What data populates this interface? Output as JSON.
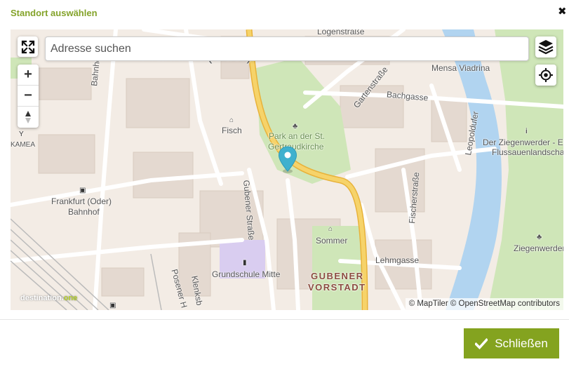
{
  "modal": {
    "title": "Standort auswählen",
    "close_symbol": "✖",
    "close_button_label": "Schließen"
  },
  "search": {
    "placeholder": "Adresse suchen",
    "value": ""
  },
  "map": {
    "zoom_in": "+",
    "zoom_out": "−",
    "attribution": "© MapTiler © OpenStreetMap contributors",
    "brand_main": "destination.",
    "brand_accent": "one",
    "labels": {
      "city": "Frankfurt (Oder)",
      "logenstrasse": "Logenstraße",
      "mensa": "Mensa Viadrina",
      "bahnhofstr": "Bahnhofst",
      "gartenstrasse": "Gartenstraße",
      "bachgasse": "Bachgasse",
      "fisch": "Fisch",
      "park1": "Park an der St.",
      "park2": "Gertraudkirche",
      "kamea": "KAMEA",
      "ziegenwerder1": "Der Ziegenwerder - Ei",
      "ziegenwerder2": "Flussauenlandschaf",
      "leopoldufer": "Leopoldufer",
      "bahnhof1": "Frankfurt (Oder)",
      "bahnhof2": "Bahnhof",
      "gubener_strasse": "Gubener Straße",
      "fischerstrasse": "Fischerstraße",
      "sommer": "Sommer",
      "ziegenwerder": "Ziegenwerder",
      "lehmgasse": "Lehmgasse",
      "grundschule": "Grundschule Mitte",
      "district1": "GUBENER",
      "district2": "VORSTADT",
      "posener": "Posener H",
      "klenksb": "Klenksb"
    }
  },
  "icons": {
    "close": "close-icon",
    "fullscreen": "fullscreen-icon",
    "layers": "layers-icon",
    "locate": "locate-icon",
    "compass": "compass-icon",
    "marker": "map-marker-icon",
    "check": "check-icon"
  },
  "colors": {
    "accent": "#84a31f",
    "title": "#84a32a",
    "marker": "#3fb1ce",
    "water": "#b1d4f0",
    "green": "#cfe6b8",
    "road_major": "#f3c24a"
  }
}
